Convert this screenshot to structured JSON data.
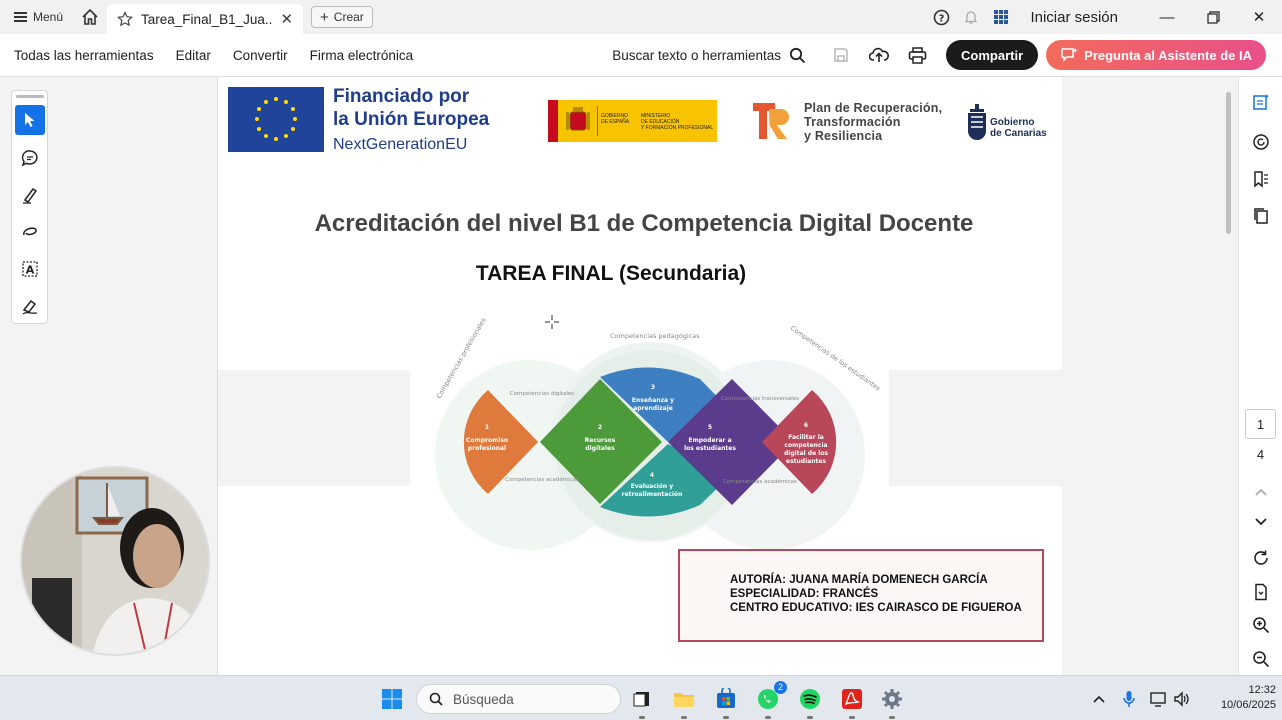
{
  "titlebar": {
    "menu_label": "Menú",
    "tab_title": "Tarea_Final_B1_Jua...",
    "new_tab_label": "Crear",
    "signin_label": "Iniciar sesión"
  },
  "toolbar": {
    "menus": [
      "Todas las herramientas",
      "Editar",
      "Convertir",
      "Firma electrónica"
    ],
    "search_label": "Buscar texto o herramientas",
    "share_label": "Compartir",
    "ai_label": "Pregunta al Asistente de IA"
  },
  "document": {
    "eu_title_line1": "Financiado por",
    "eu_title_line2": "la Unión Europea",
    "eu_subtitle": "NextGenerationEU",
    "spain_logo_line1": "GOBIERNO",
    "spain_logo_line2": "DE ESPAÑA",
    "ministry_line1": "MINISTERIO",
    "ministry_line2": "DE EDUCACIÓN",
    "ministry_line3": "Y FORMACIÓN PROFESIONAL",
    "prtr_line1": "Plan de Recuperación,",
    "prtr_line2": "Transformación",
    "prtr_line3": "y Resiliencia",
    "canarias_line1": "Gobierno",
    "canarias_line2": "de Canarias",
    "heading": "Acreditación del nivel B1 de Competencia Digital Docente",
    "subheading": "TAREA FINAL (Secundaria)",
    "diagram": {
      "arc_professional": "Competencias profesionales",
      "arc_pedagogic": "Competencias pedagógicas",
      "arc_students": "Competencias de los estudiantes",
      "label_digital": "Competencias digitales",
      "label_academic": "Competencias académicas",
      "label_transversal": "Competencias transversales",
      "label_academic2": "Competencias académicas",
      "areas": [
        {
          "num": "1",
          "line1": "Compromiso",
          "line2": "profesional",
          "color": "#e07a3c"
        },
        {
          "num": "2",
          "line1": "Recursos",
          "line2": "digitales",
          "color": "#4c9a3a"
        },
        {
          "num": "3",
          "line1": "Enseñanza y",
          "line2": "aprendizaje",
          "color": "#3d7fc0"
        },
        {
          "num": "4",
          "line1": "Evaluación y",
          "line2": "retroalimentación",
          "color": "#2f9f98"
        },
        {
          "num": "5",
          "line1": "Empoderar a",
          "line2": "los estudiantes",
          "color": "#5b3c8c"
        },
        {
          "num": "6",
          "line1": "Facilitar la",
          "line2": "competencia",
          "line3": "digital de los",
          "line4": "estudiantes",
          "color": "#b9475a"
        }
      ]
    },
    "author": "AUTORÍA: JUANA MARÍA DOMENECH GARCÍA",
    "specialty": "ESPECIALIDAD: FRANCÉS",
    "school": "CENTRO EDUCATIVO: IES CAIRASCO DE FIGUEROA"
  },
  "pager": {
    "current": "1",
    "total": "4"
  },
  "taskbar": {
    "search_placeholder": "Búsqueda",
    "whatsapp_badge": "2",
    "time": "12:32",
    "date": "10/06/2025"
  }
}
